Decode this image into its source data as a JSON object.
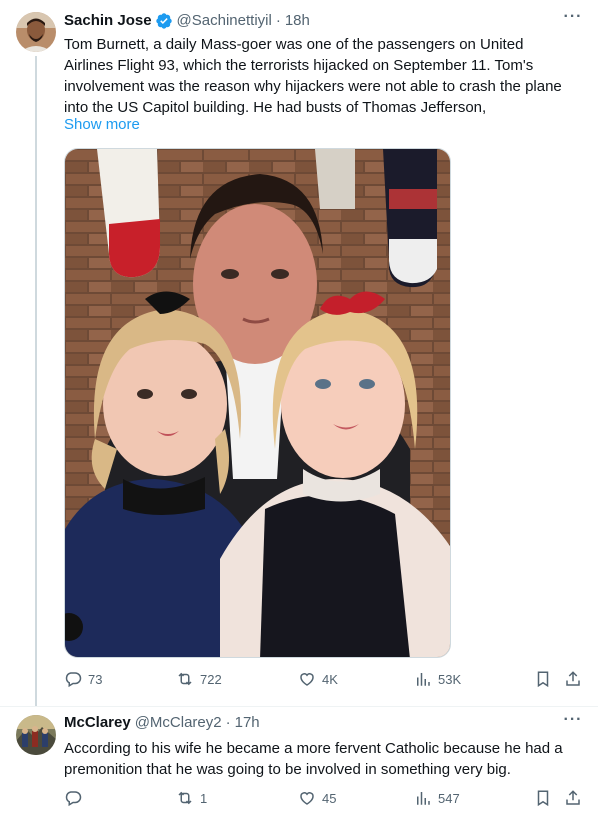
{
  "tweets": [
    {
      "author": "Sachin Jose",
      "handle": "@Sachinettiyil",
      "separator": "·",
      "time": "18h",
      "text": "Tom Burnett, a daily Mass-goer was one of the passengers on United\nAirlines Flight 93, which the terrorists hijacked on September 11. Tom's\ninvolvement was the reason why hijackers were not able to crash the plane\ninto the US Capitol building. He had busts of Thomas Jefferson,",
      "show_more": "Show more",
      "more_glyph": "···",
      "stats": {
        "replies": "73",
        "reposts": "722",
        "likes": "4K",
        "views": "53K"
      }
    },
    {
      "author": "McClarey",
      "handle": "@McClarey2",
      "separator": "·",
      "time": "17h",
      "text": "According to his wife he became a more fervent Catholic because he had a\npremonition that he was going to be involved in something very big.",
      "more_glyph": "···",
      "stats": {
        "replies": "",
        "reposts": "1",
        "likes": "45",
        "views": "547"
      }
    }
  ],
  "colors": {
    "text": "#0f1419",
    "muted": "#536471",
    "link": "#1d9bf0",
    "verified": "#1d9bf0",
    "divider": "#eff3f4"
  }
}
